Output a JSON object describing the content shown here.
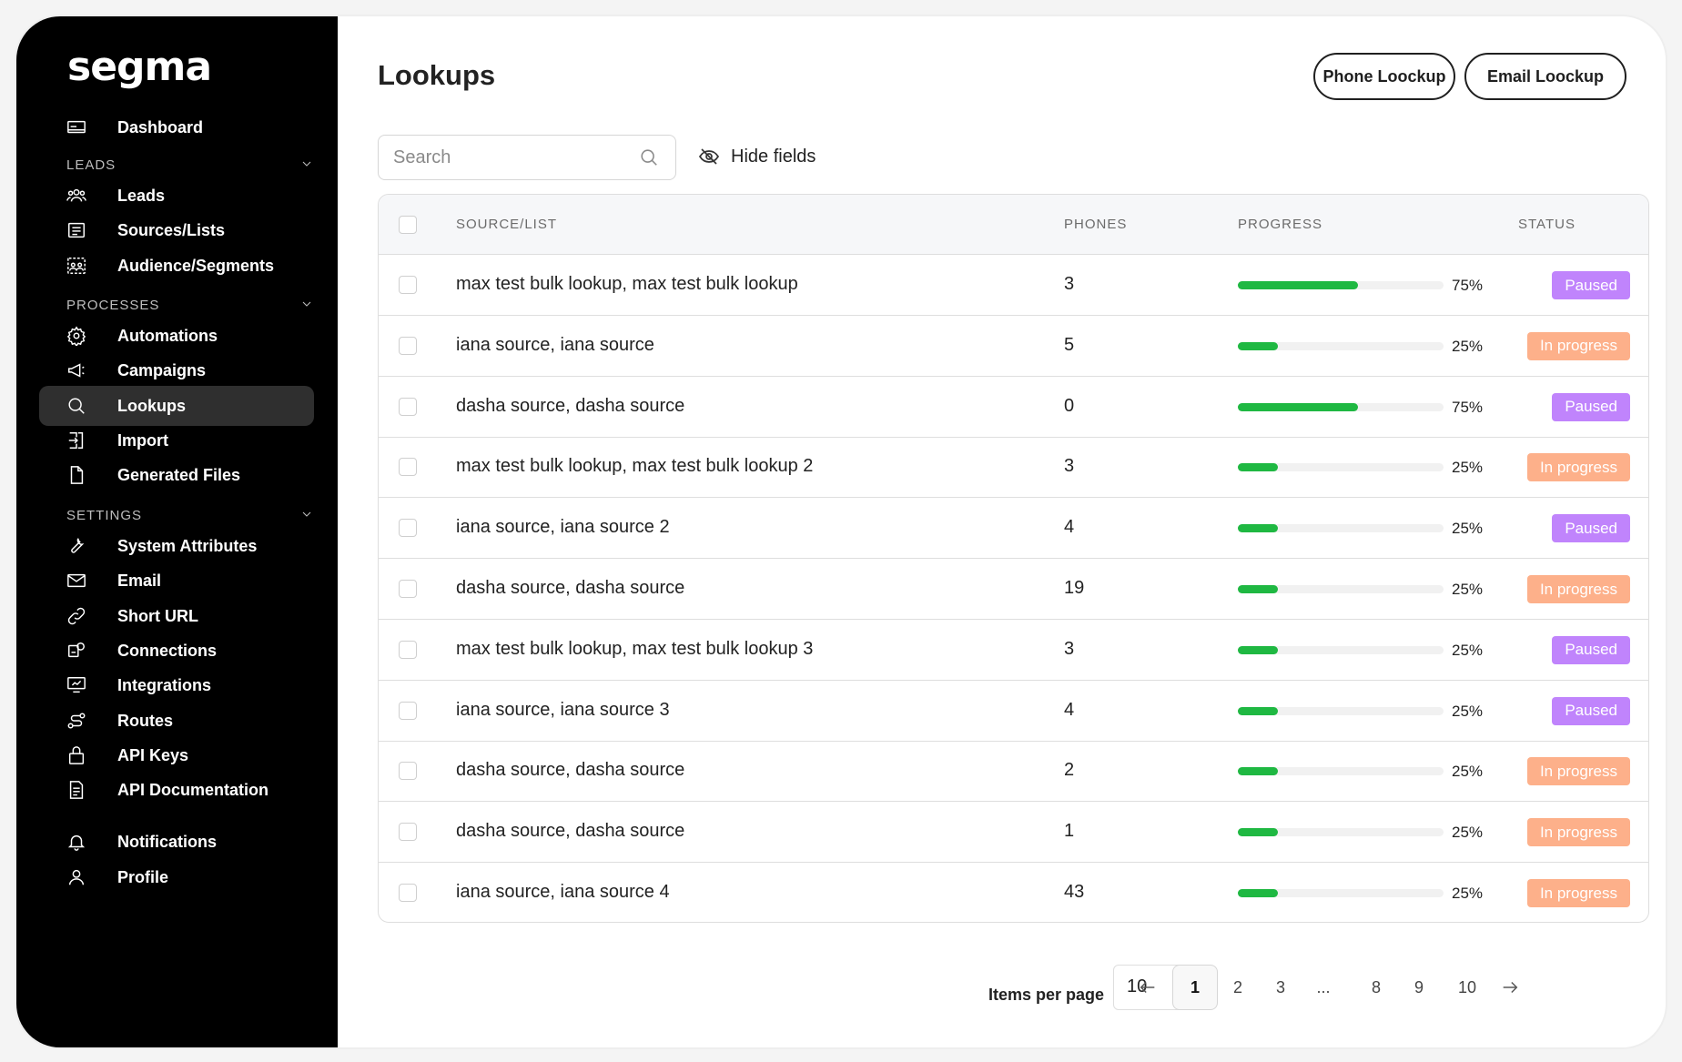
{
  "app": {
    "logo": "segma"
  },
  "sidebar": {
    "top_items": [
      {
        "label": "Dashboard",
        "icon": "dashboard-icon"
      }
    ],
    "sections": [
      {
        "label": "LEADS",
        "items": [
          {
            "label": "Leads",
            "icon": "users-icon"
          },
          {
            "label": "Sources/Lists",
            "icon": "list-icon"
          },
          {
            "label": "Audience/Segments",
            "icon": "audience-icon"
          }
        ]
      },
      {
        "label": "PROCESSES",
        "items": [
          {
            "label": "Automations",
            "icon": "gear-icon"
          },
          {
            "label": "Campaigns",
            "icon": "megaphone-icon"
          },
          {
            "label": "Lookups",
            "icon": "search-icon",
            "active": true
          },
          {
            "label": "Import",
            "icon": "import-icon"
          },
          {
            "label": "Generated Files",
            "icon": "file-icon"
          }
        ]
      },
      {
        "label": "SETTINGS",
        "items": [
          {
            "label": "System Attributes",
            "icon": "wrench-icon"
          },
          {
            "label": "Email",
            "icon": "mail-icon"
          },
          {
            "label": "Short URL",
            "icon": "link-icon"
          },
          {
            "label": "Connections",
            "icon": "connections-icon"
          },
          {
            "label": "Integrations",
            "icon": "integrations-icon"
          },
          {
            "label": "Routes",
            "icon": "routes-icon"
          },
          {
            "label": "API Keys",
            "icon": "lock-icon"
          },
          {
            "label": "API Documentation",
            "icon": "document-icon"
          }
        ]
      }
    ],
    "bottom_items": [
      {
        "label": "Notifications",
        "icon": "bell-icon"
      },
      {
        "label": "Profile",
        "icon": "user-icon"
      }
    ]
  },
  "header": {
    "title": "Lookups",
    "phone_lookup_label": "Phone Loockup",
    "email_lookup_label": "Email Loockup"
  },
  "toolbar": {
    "search_placeholder": "Search",
    "hide_fields_label": "Hide fields"
  },
  "table": {
    "columns": [
      "SOURCE/LIST",
      "PHONES",
      "PROGRESS",
      "STATUS"
    ],
    "rows": [
      {
        "source": "max test bulk lookup, max test bulk lookup",
        "phones": "3",
        "progress": 0.75,
        "progress_label": "75%",
        "status": "Paused"
      },
      {
        "source": "iana source, iana source",
        "phones": "5",
        "progress": 0.25,
        "progress_label": "25%",
        "status": "In progress"
      },
      {
        "source": "dasha source, dasha source",
        "phones": "0",
        "progress": 0.75,
        "progress_label": "75%",
        "status": "Paused"
      },
      {
        "source": "max test bulk lookup, max test bulk lookup 2",
        "phones": "3",
        "progress": 0.25,
        "progress_label": "25%",
        "status": "In progress"
      },
      {
        "source": "iana source, iana source 2",
        "phones": "4",
        "progress": 0.25,
        "progress_label": "25%",
        "status": "Paused"
      },
      {
        "source": "dasha source, dasha source",
        "phones": "19",
        "progress": 0.25,
        "progress_label": "25%",
        "status": "In progress"
      },
      {
        "source": "max test bulk lookup, max test bulk lookup 3",
        "phones": "3",
        "progress": 0.25,
        "progress_label": "25%",
        "status": "Paused"
      },
      {
        "source": "iana source, iana source 3",
        "phones": "4",
        "progress": 0.25,
        "progress_label": "25%",
        "status": "Paused"
      },
      {
        "source": "dasha source, dasha source",
        "phones": "2",
        "progress": 0.25,
        "progress_label": "25%",
        "status": "In progress"
      },
      {
        "source": "dasha source, dasha source",
        "phones": "1",
        "progress": 0.25,
        "progress_label": "25%",
        "status": "In progress"
      },
      {
        "source": "iana source, iana source 4",
        "phones": "43",
        "progress": 0.25,
        "progress_label": "25%",
        "status": "In progress"
      }
    ]
  },
  "status_colors": {
    "Paused": "#c084fc",
    "In progress": "#fdb08a"
  },
  "colors": {
    "progress_fill": "#1fb842",
    "sidebar_bg": "#000000",
    "active_item_bg": "#2f2f2f"
  },
  "pagination": {
    "items_per_page_label": "Items per page",
    "items_per_page_value": "10",
    "pages": [
      "1",
      "2",
      "3",
      "...",
      "8",
      "9",
      "10"
    ],
    "current_page": "1"
  }
}
